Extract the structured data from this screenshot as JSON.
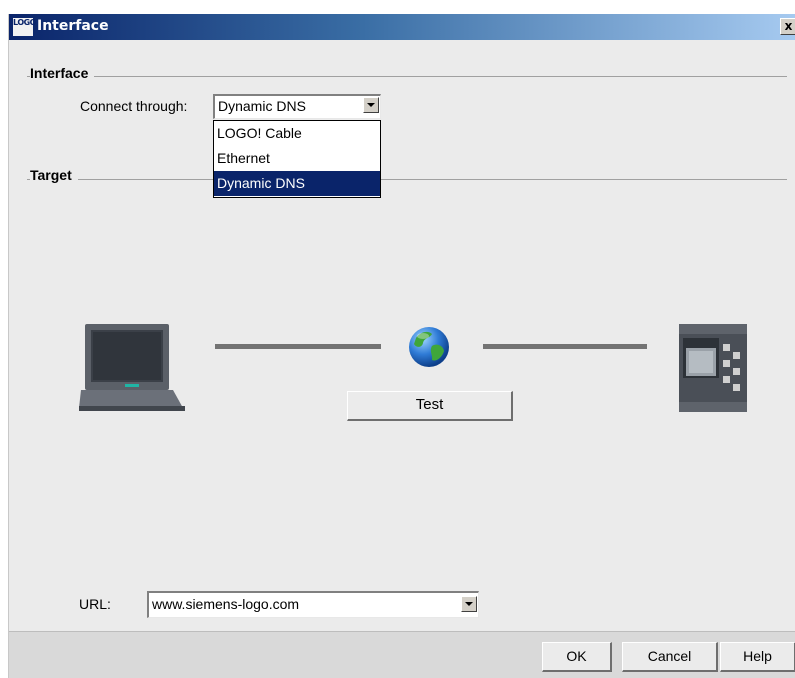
{
  "window": {
    "title": "Interface",
    "logo_text": "LOGO",
    "close_label": "x"
  },
  "interface_section": {
    "heading": "Interface",
    "connect_label": "Connect through:",
    "connect_value": "Dynamic DNS",
    "options": [
      "LOGO! Cable",
      "Ethernet",
      "Dynamic DNS"
    ],
    "selected_index": 2
  },
  "target_section": {
    "heading": "Target",
    "test_button": "Test"
  },
  "url_field": {
    "label": "URL:",
    "value": "www.siemens-logo.com"
  },
  "buttons": {
    "ok": "OK",
    "cancel": "Cancel",
    "help": "Help"
  },
  "icons": {
    "laptop": "laptop-icon",
    "globe": "globe-icon",
    "plc": "plc-module-icon"
  },
  "colors": {
    "title_bar_start": "#0a246a",
    "title_bar_end": "#a6caf0",
    "selection": "#0a246a",
    "dialog_bg": "#ebebeb"
  }
}
